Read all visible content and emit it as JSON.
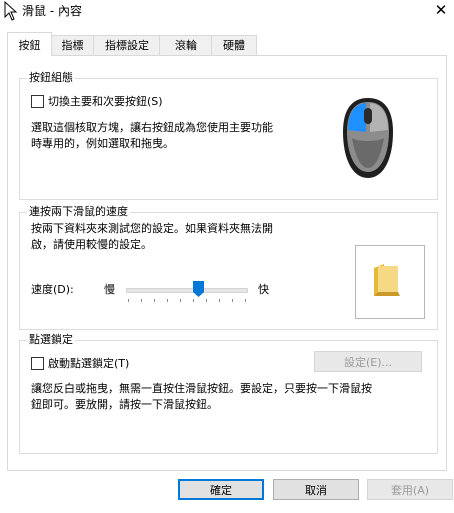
{
  "window": {
    "title": "滑鼠 - 內容",
    "close_glyph": "✕"
  },
  "tabs": [
    {
      "label": "按鈕",
      "active": true
    },
    {
      "label": "指標",
      "active": false
    },
    {
      "label": "指標設定",
      "active": false
    },
    {
      "label": "滾輪",
      "active": false
    },
    {
      "label": "硬體",
      "active": false
    }
  ],
  "button_config": {
    "group_title": "按鈕組態",
    "switch_checkbox_label": "切換主要和次要按鈕(S)",
    "switch_checked": false,
    "description_line1": "選取這個核取方塊，讓右按鈕成為您使用主要功能",
    "description_line2": "時專用的，例如選取和拖曳。"
  },
  "double_click": {
    "group_title": "連按兩下滑鼠的速度",
    "description_line1": "按兩下資料夾來測試您的設定。如果資料夾無法開",
    "description_line2": "啟，請使用較慢的設定。",
    "speed_label": "速度(D):",
    "slow_label": "慢",
    "fast_label": "快",
    "speed_value_fraction": 0.6
  },
  "click_lock": {
    "group_title": "點選鎖定",
    "checkbox_label": "啟動點選鎖定(T)",
    "checked": false,
    "settings_button": "設定(E)...",
    "description_line1": "讓您反白或拖曳，無需一直按住滑鼠按鈕。要設定，只要按一下滑鼠按",
    "description_line2": "鈕即可。要放開，請按一下滑鼠按鈕。"
  },
  "footer": {
    "ok": "確定",
    "cancel": "取消",
    "apply": "套用(A)"
  },
  "colors": {
    "accent": "#0078d7",
    "mouse_highlight": "#1e90ff",
    "folder": "#f4d35e"
  }
}
